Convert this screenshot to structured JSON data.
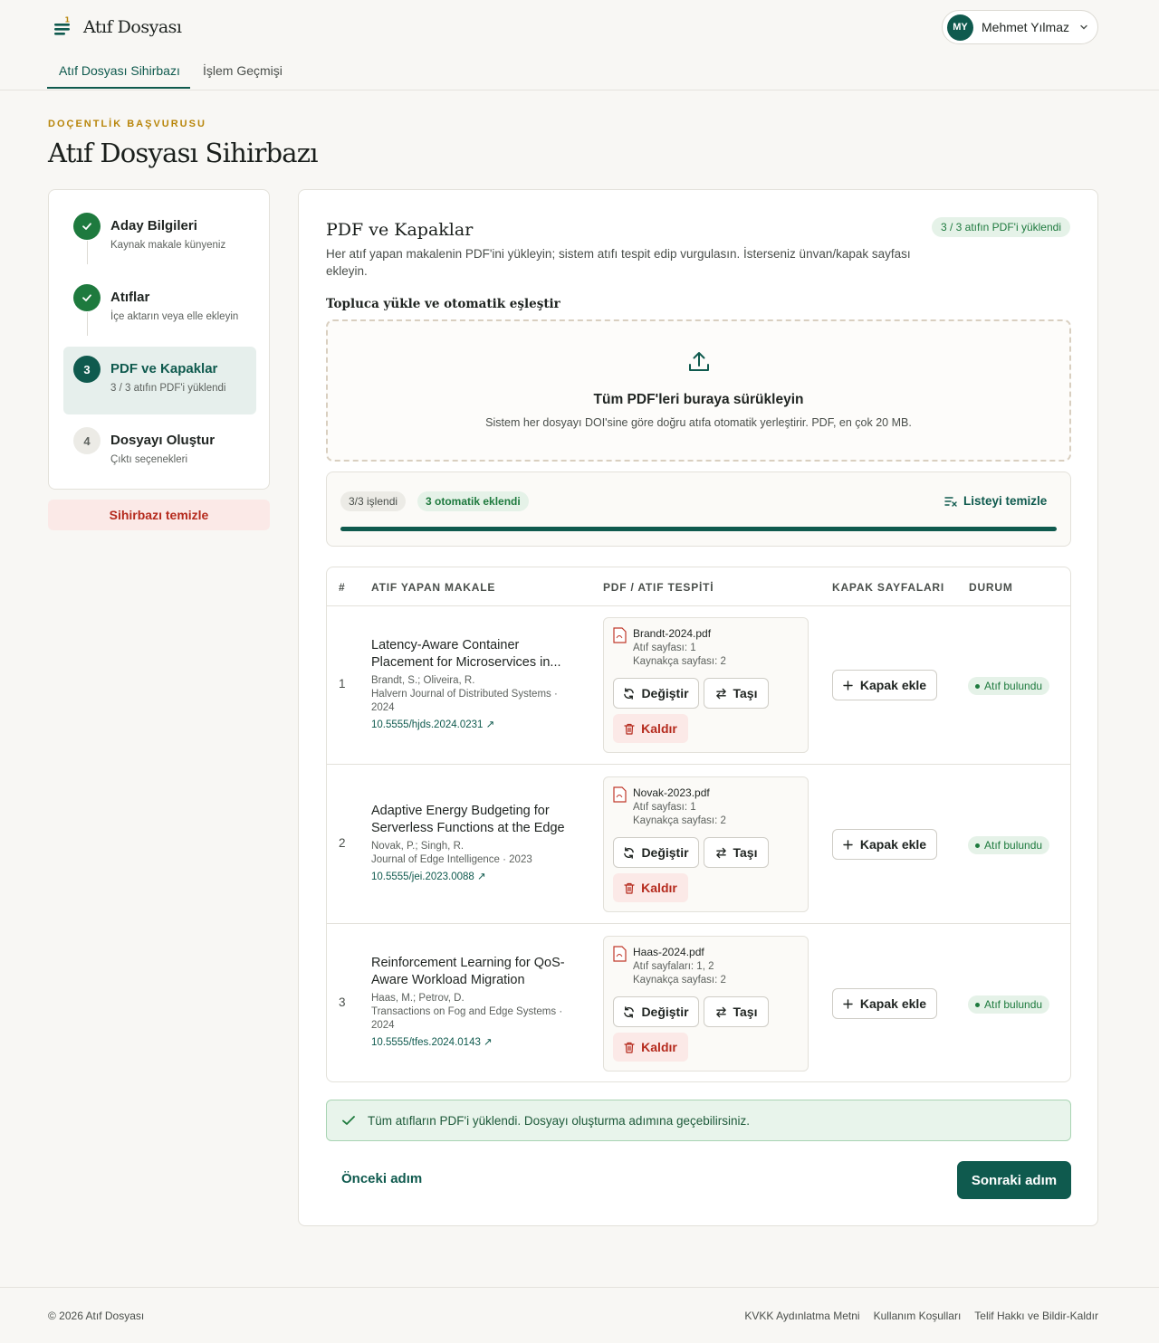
{
  "app": {
    "name": "Atıf Dosyası"
  },
  "user": {
    "initials": "MY",
    "name": "Mehmet Yılmaz"
  },
  "tabs": [
    {
      "label": "Atıf Dosyası Sihirbazı",
      "active": true
    },
    {
      "label": "İşlem Geçmişi",
      "active": false
    }
  ],
  "page": {
    "eyebrow": "DOÇENTLİK BAŞVURUSU",
    "title": "Atıf Dosyası Sihirbazı"
  },
  "steps": [
    {
      "num": "1",
      "title": "Aday Bilgileri",
      "sub": "Kaynak makale künyeniz",
      "state": "done"
    },
    {
      "num": "2",
      "title": "Atıflar",
      "sub": "İçe aktarın veya elle ekleyin",
      "state": "done"
    },
    {
      "num": "3",
      "title": "PDF ve Kapaklar",
      "sub": "3 / 3 atıfın PDF'i yüklendi",
      "state": "current"
    },
    {
      "num": "4",
      "title": "Dosyayı Oluştur",
      "sub": "Çıktı seçenekleri",
      "state": "pending"
    }
  ],
  "reset_label": "Sihirbazı temizle",
  "section": {
    "title": "PDF ve Kapaklar",
    "description": "Her atıf yapan makalenin PDF'ini yükleyin; sistem atıfı tespit edip vurgulasın. İsterseniz ünvan/kapak sayfası ekleyin.",
    "badge": "3 / 3 atıfın PDF'i yüklendi",
    "bulk_title": "Topluca yükle ve otomatik eşleştir"
  },
  "dropzone": {
    "title": "Tüm PDF'leri buraya sürükleyin",
    "subtitle": "Sistem her dosyayı DOI'sine göre doğru atıfa otomatik yerleştirir. PDF, en çok 20 MB."
  },
  "progress": {
    "processed": "3/3 işlendi",
    "auto_added": "3 otomatik eklendi",
    "clear_label": "Listeyi temizle",
    "fraction": 1.0
  },
  "table": {
    "headers": {
      "num": "#",
      "article": "ATIF YAPAN MAKALE",
      "pdf": "PDF / ATIF TESPİTİ",
      "cover": "KAPAK SAYFALARI",
      "status": "DURUM"
    },
    "rows": [
      {
        "num": "1",
        "title": "Latency-Aware Container Placement for Microservices in...",
        "authors": "Brandt, S.; Oliveira, R.",
        "journal": "Halvern Journal of Distributed Systems · 2024",
        "doi": "10.5555/hjds.2024.0231 ↗",
        "pdf_name": "Brandt-2024.pdf",
        "cite_pages": "Atıf sayfası: 1",
        "ref_pages": "Kaynakça sayfası: 2",
        "btn_replace": "Değiştir",
        "btn_move": "Taşı",
        "btn_remove": "Kaldır",
        "cover_label": "Kapak ekle",
        "status": "Atıf bulundu"
      },
      {
        "num": "2",
        "title": "Adaptive Energy Budgeting for Serverless Functions at the Edge",
        "authors": "Novak, P.; Singh, R.",
        "journal": "Journal of Edge Intelligence · 2023",
        "doi": "10.5555/jei.2023.0088 ↗",
        "pdf_name": "Novak-2023.pdf",
        "cite_pages": "Atıf sayfası: 1",
        "ref_pages": "Kaynakça sayfası: 2",
        "btn_replace": "Değiştir",
        "btn_move": "Taşı",
        "btn_remove": "Kaldır",
        "cover_label": "Kapak ekle",
        "status": "Atıf bulundu"
      },
      {
        "num": "3",
        "title": "Reinforcement Learning for QoS-Aware Workload Migration",
        "authors": "Haas, M.; Petrov, D.",
        "journal": "Transactions on Fog and Edge Systems · 2024",
        "doi": "10.5555/tfes.2024.0143 ↗",
        "pdf_name": "Haas-2024.pdf",
        "cite_pages": "Atıf sayfaları: 1, 2",
        "ref_pages": "Kaynakça sayfası: 2",
        "btn_replace": "Değiştir",
        "btn_move": "Taşı",
        "btn_remove": "Kaldır",
        "cover_label": "Kapak ekle",
        "status": "Atıf bulundu"
      }
    ]
  },
  "alert": "Tüm atıfların PDF'i yüklendi. Dosyayı oluşturma adımına geçebilirsiniz.",
  "nav": {
    "prev": "Önceki adım",
    "next": "Sonraki adım"
  },
  "footer": {
    "copyright": "© 2026 Atıf Dosyası",
    "links": [
      "KVKK Aydınlatma Metni",
      "Kullanım Koşulları",
      "Telif Hakkı ve Bildir-Kaldır"
    ]
  },
  "colors": {
    "primary": "#0f5a4e",
    "success": "#1e7a3e",
    "danger": "#b52a1d",
    "accent": "#b8860b"
  }
}
